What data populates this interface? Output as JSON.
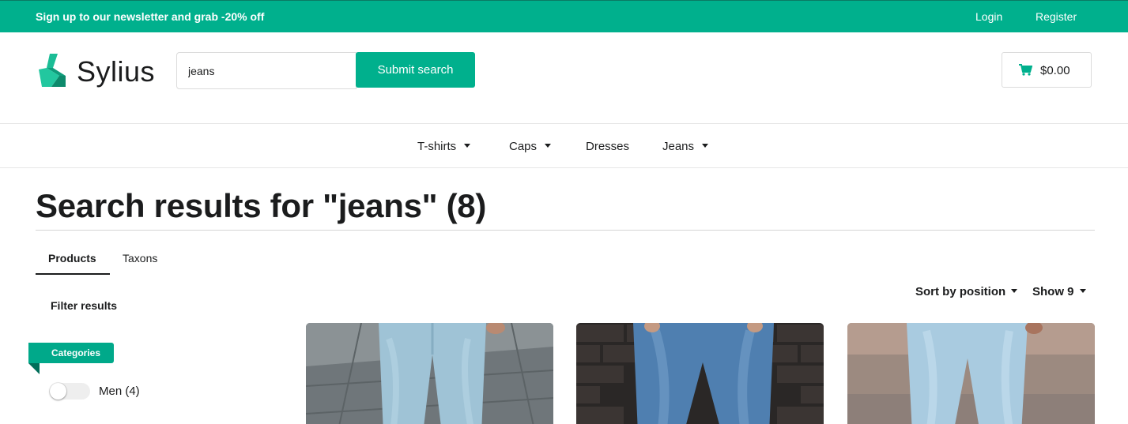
{
  "topbar": {
    "promo": "Sign up to our newsletter and grab -20% off",
    "login": "Login",
    "register": "Register"
  },
  "header": {
    "logo_text": "Sylius",
    "search": {
      "value": "jeans",
      "button": "Submit search"
    },
    "cart": {
      "amount": "$0.00",
      "icon": "cart-icon"
    }
  },
  "nav": {
    "items": [
      {
        "label": "T-shirts",
        "has_dropdown": true
      },
      {
        "label": "Caps",
        "has_dropdown": true
      },
      {
        "label": "Dresses",
        "has_dropdown": false
      },
      {
        "label": "Jeans",
        "has_dropdown": true
      }
    ]
  },
  "main": {
    "title": "Search results for \"jeans\" (8)",
    "tabs": [
      {
        "label": "Products",
        "active": true
      },
      {
        "label": "Taxons",
        "active": false
      }
    ],
    "filter": {
      "heading": "Filter results",
      "section": "Categories",
      "options": [
        {
          "label": "Men (4)",
          "checked": false
        }
      ]
    },
    "sorting": {
      "sort_label": "Sort by position",
      "show_label": "Show 9"
    },
    "products": [
      {
        "image": "jeans-photo-grey-pavement"
      },
      {
        "image": "jeans-photo-brick-wall"
      },
      {
        "image": "jeans-photo-street"
      }
    ]
  },
  "colors": {
    "accent": "#00b08d",
    "text": "#1b1c1d",
    "border": "#dcdcdc"
  }
}
